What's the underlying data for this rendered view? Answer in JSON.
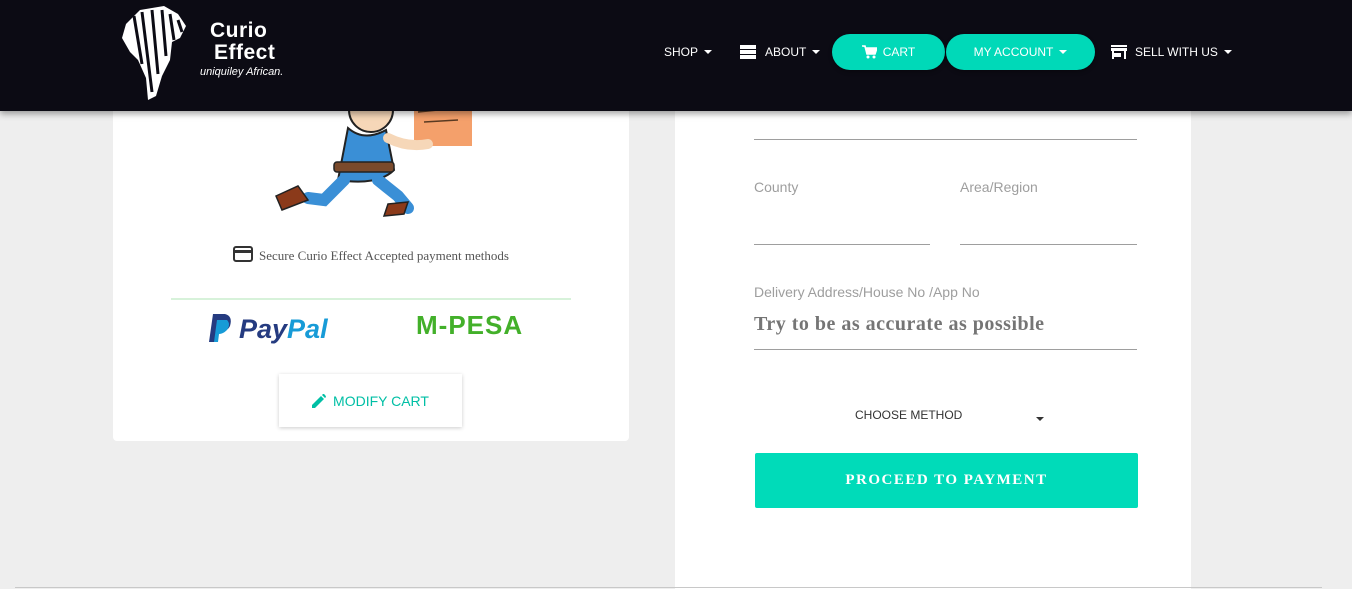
{
  "brand": {
    "line1": "Curio",
    "line2": "Effect",
    "tagline": "uniquiley African."
  },
  "nav": {
    "shop": "SHOP",
    "about": "ABOUT",
    "cart": "CART",
    "account": "MY ACCOUNT",
    "sell": "SELL WITH US"
  },
  "left": {
    "secure_text": "Secure Curio Effect Accepted payment methods",
    "paypal": {
      "part1": "Pay",
      "part2": "Pal"
    },
    "mpesa": "M-PESA",
    "modify_label": "MODIFY CART"
  },
  "form": {
    "county_label": "County",
    "area_label": "Area/Region",
    "address_label": "Delivery Address/House No /App No",
    "address_placeholder": "Try to be as accurate as possible",
    "method_label": "CHOOSE METHOD",
    "proceed_label": "PROCEED TO PAYMENT"
  },
  "colors": {
    "accent": "#00d9b8",
    "navbar": "#0c0b14",
    "background": "#eeeeee"
  }
}
